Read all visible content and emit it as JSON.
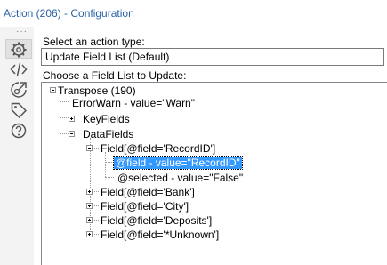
{
  "window": {
    "title": "Action (206) - Configuration"
  },
  "sidebar": {
    "dots": "···",
    "icons": [
      "gear-icon",
      "code-icon",
      "action-icon",
      "tag-icon",
      "help-icon"
    ]
  },
  "form": {
    "action_type_label": "Select an action type:",
    "action_type_value": "Update Field List (Default)",
    "field_list_label": "Choose a Field List to Update:"
  },
  "tree": {
    "root": "Transpose (190)",
    "error_warn": "ErrorWarn - value=\"Warn\"",
    "key_fields": "KeyFields",
    "data_fields": "DataFields",
    "field_recordid": "Field[@field='RecordID']",
    "field_value_selected": "@field - value=\"RecordID\"",
    "selected_value": "@selected - value=\"False\"",
    "field_bank": "Field[@field='Bank']",
    "field_city": "Field[@field='City']",
    "field_deposits": "Field[@field='Deposits']",
    "field_unknown": "Field[@field='*Unknown']"
  },
  "colors": {
    "title": "#2a62a8",
    "selection": "#3399ff",
    "sidebar_bg": "#f3f3f3"
  }
}
